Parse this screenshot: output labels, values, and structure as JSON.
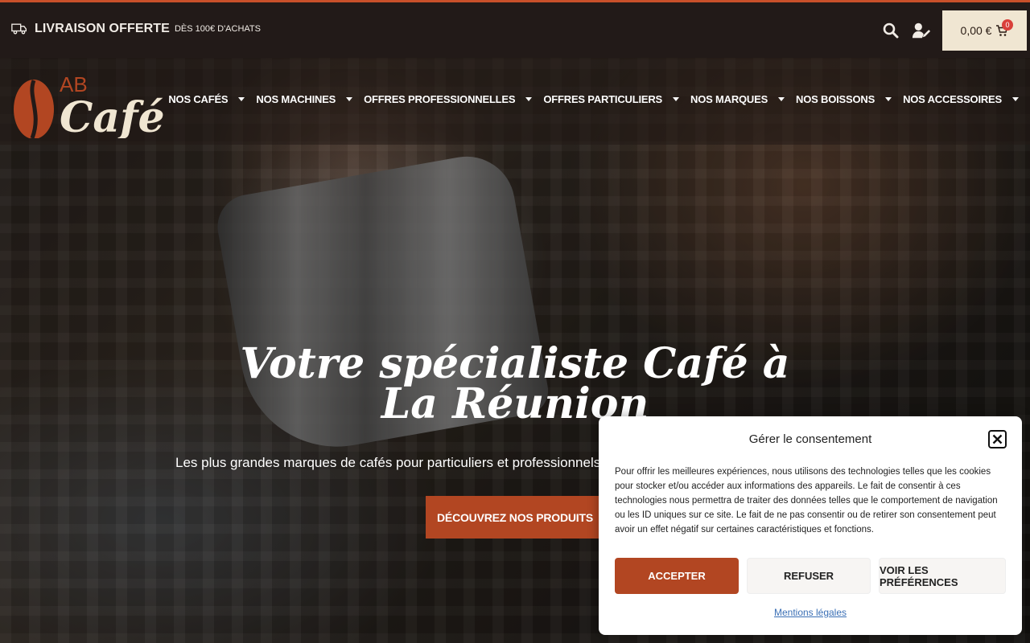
{
  "topbar": {
    "shipping_main": "LIVRAISON OFFERTE",
    "shipping_sub": "dès 100€ d'achats",
    "cart_total": "0,00 €",
    "cart_count": "0"
  },
  "logo": {
    "line1": "AB",
    "line2": "Café"
  },
  "nav": {
    "items": [
      {
        "label": "NOS CAFÉS"
      },
      {
        "label": "NOS MACHINES"
      },
      {
        "label": "OFFRES PROFESSIONNELLES"
      },
      {
        "label": "OFFRES PARTICULIERS"
      },
      {
        "label": "NOS MARQUES"
      },
      {
        "label": "NOS BOISSONS"
      },
      {
        "label": "NOS ACCESSOIRES"
      }
    ]
  },
  "hero": {
    "title": "Votre spécialiste Café à La Réunion",
    "subtitle": "Les plus grandes marques de cafés pour particuliers et professionnels",
    "cta": "DÉCOUVREZ NOS PRODUITS"
  },
  "consent": {
    "title": "Gérer le consentement",
    "text": "Pour offrir les meilleures expériences, nous utilisons des technologies telles que les cookies pour stocker et/ou accéder aux informations des appareils. Le fait de consentir à ces technologies nous permettra de traiter des données telles que le comportement de navigation ou les ID uniques sur ce site. Le fait de ne pas consentir ou de retirer son consentement peut avoir un effet négatif sur certaines caractéristiques et fonctions.",
    "accept": "ACCEPTER",
    "refuse": "REFUSER",
    "preferences": "VOIR LES PRÉFÉRENCES",
    "legal_link": "Mentions légales"
  },
  "colors": {
    "accent": "#b24622",
    "topbar_bg": "#221a18",
    "cart_bg": "#f0e6d2",
    "badge": "#d9403a",
    "link": "#3a6fb5"
  },
  "icons": [
    "truck-icon",
    "search-icon",
    "user-edit-icon",
    "cart-icon",
    "close-icon",
    "chevron-down-icon"
  ]
}
